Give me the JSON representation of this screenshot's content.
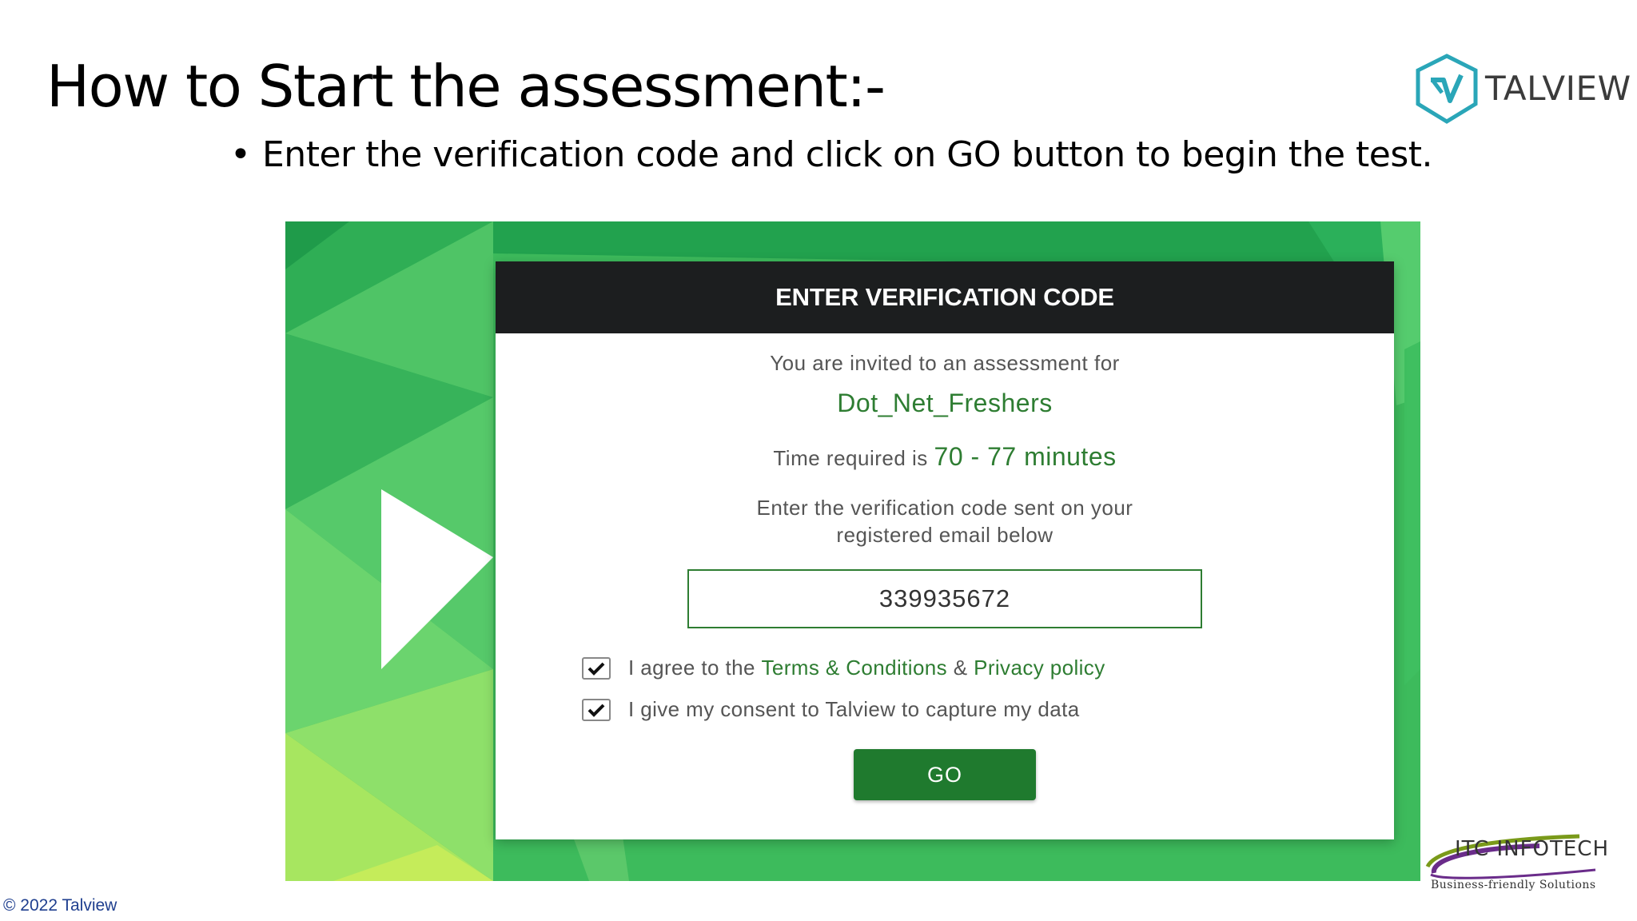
{
  "slide": {
    "title": "How to Start the assessment:-",
    "bullet": "Enter the verification code and click on GO button to begin the test.",
    "bullet_marker": "•",
    "footer": "© 2022 Talview"
  },
  "brand": {
    "name": "TALVIEW",
    "icon": "talview-hexagon-logo-icon",
    "accent": "#2aa6b8"
  },
  "partner": {
    "name": "ITC INFOTECH",
    "tagline": "Business-friendly Solutions",
    "icon": "itc-infotech-logo-icon"
  },
  "dialog": {
    "header": "ENTER VERIFICATION CODE",
    "invite_text": "You are invited to an assessment for",
    "assessment_name": "Dot_Net_Freshers",
    "time_prefix": "Time required is",
    "time_value": "70 - 77 minutes",
    "instruction_line1": "Enter the verification code sent on your",
    "instruction_line2": "registered email below",
    "code_value": "339935672",
    "terms": {
      "checked": true,
      "prefix": "I agree to the",
      "terms_link": "Terms & Conditions",
      "joiner": "&",
      "privacy_link": "Privacy policy"
    },
    "consent": {
      "checked": true,
      "label": "I give my consent to Talview to capture my data"
    },
    "go_label": "GO"
  },
  "colors": {
    "header_bg": "#1c1e1f",
    "accent_green": "#2e7d32",
    "button_green": "#1f7a2e",
    "footer_text": "#1f3f8f"
  }
}
